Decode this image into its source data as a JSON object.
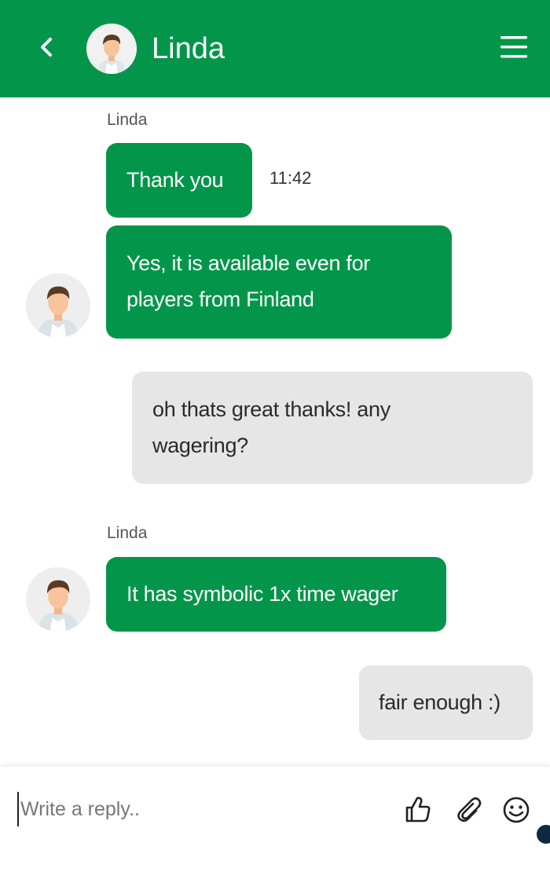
{
  "header": {
    "contact_name": "Linda",
    "background": "#03964a",
    "back_icon": "chevron-left-icon",
    "menu_icon": "hamburger-menu-icon"
  },
  "messages": [
    {
      "from": "agent",
      "sender": "Linda",
      "text": "Thank you",
      "time": "11:42"
    },
    {
      "from": "agent",
      "text_lines": [
        "Yes, it is available even for",
        "players from Finland"
      ]
    },
    {
      "from": "user",
      "text_lines": [
        "oh thats great thanks! any",
        "wagering?"
      ]
    },
    {
      "from": "agent",
      "sender": "Linda",
      "text": "It has symbolic 1x time wager"
    },
    {
      "from": "user",
      "text": "fair enough :)"
    }
  ],
  "composer": {
    "placeholder": "Write a reply..",
    "icons": [
      "thumbs-up-icon",
      "paperclip-icon",
      "smiley-icon"
    ]
  },
  "colors": {
    "agent_bubble": "#03964a",
    "user_bubble": "#e6e6e6"
  }
}
